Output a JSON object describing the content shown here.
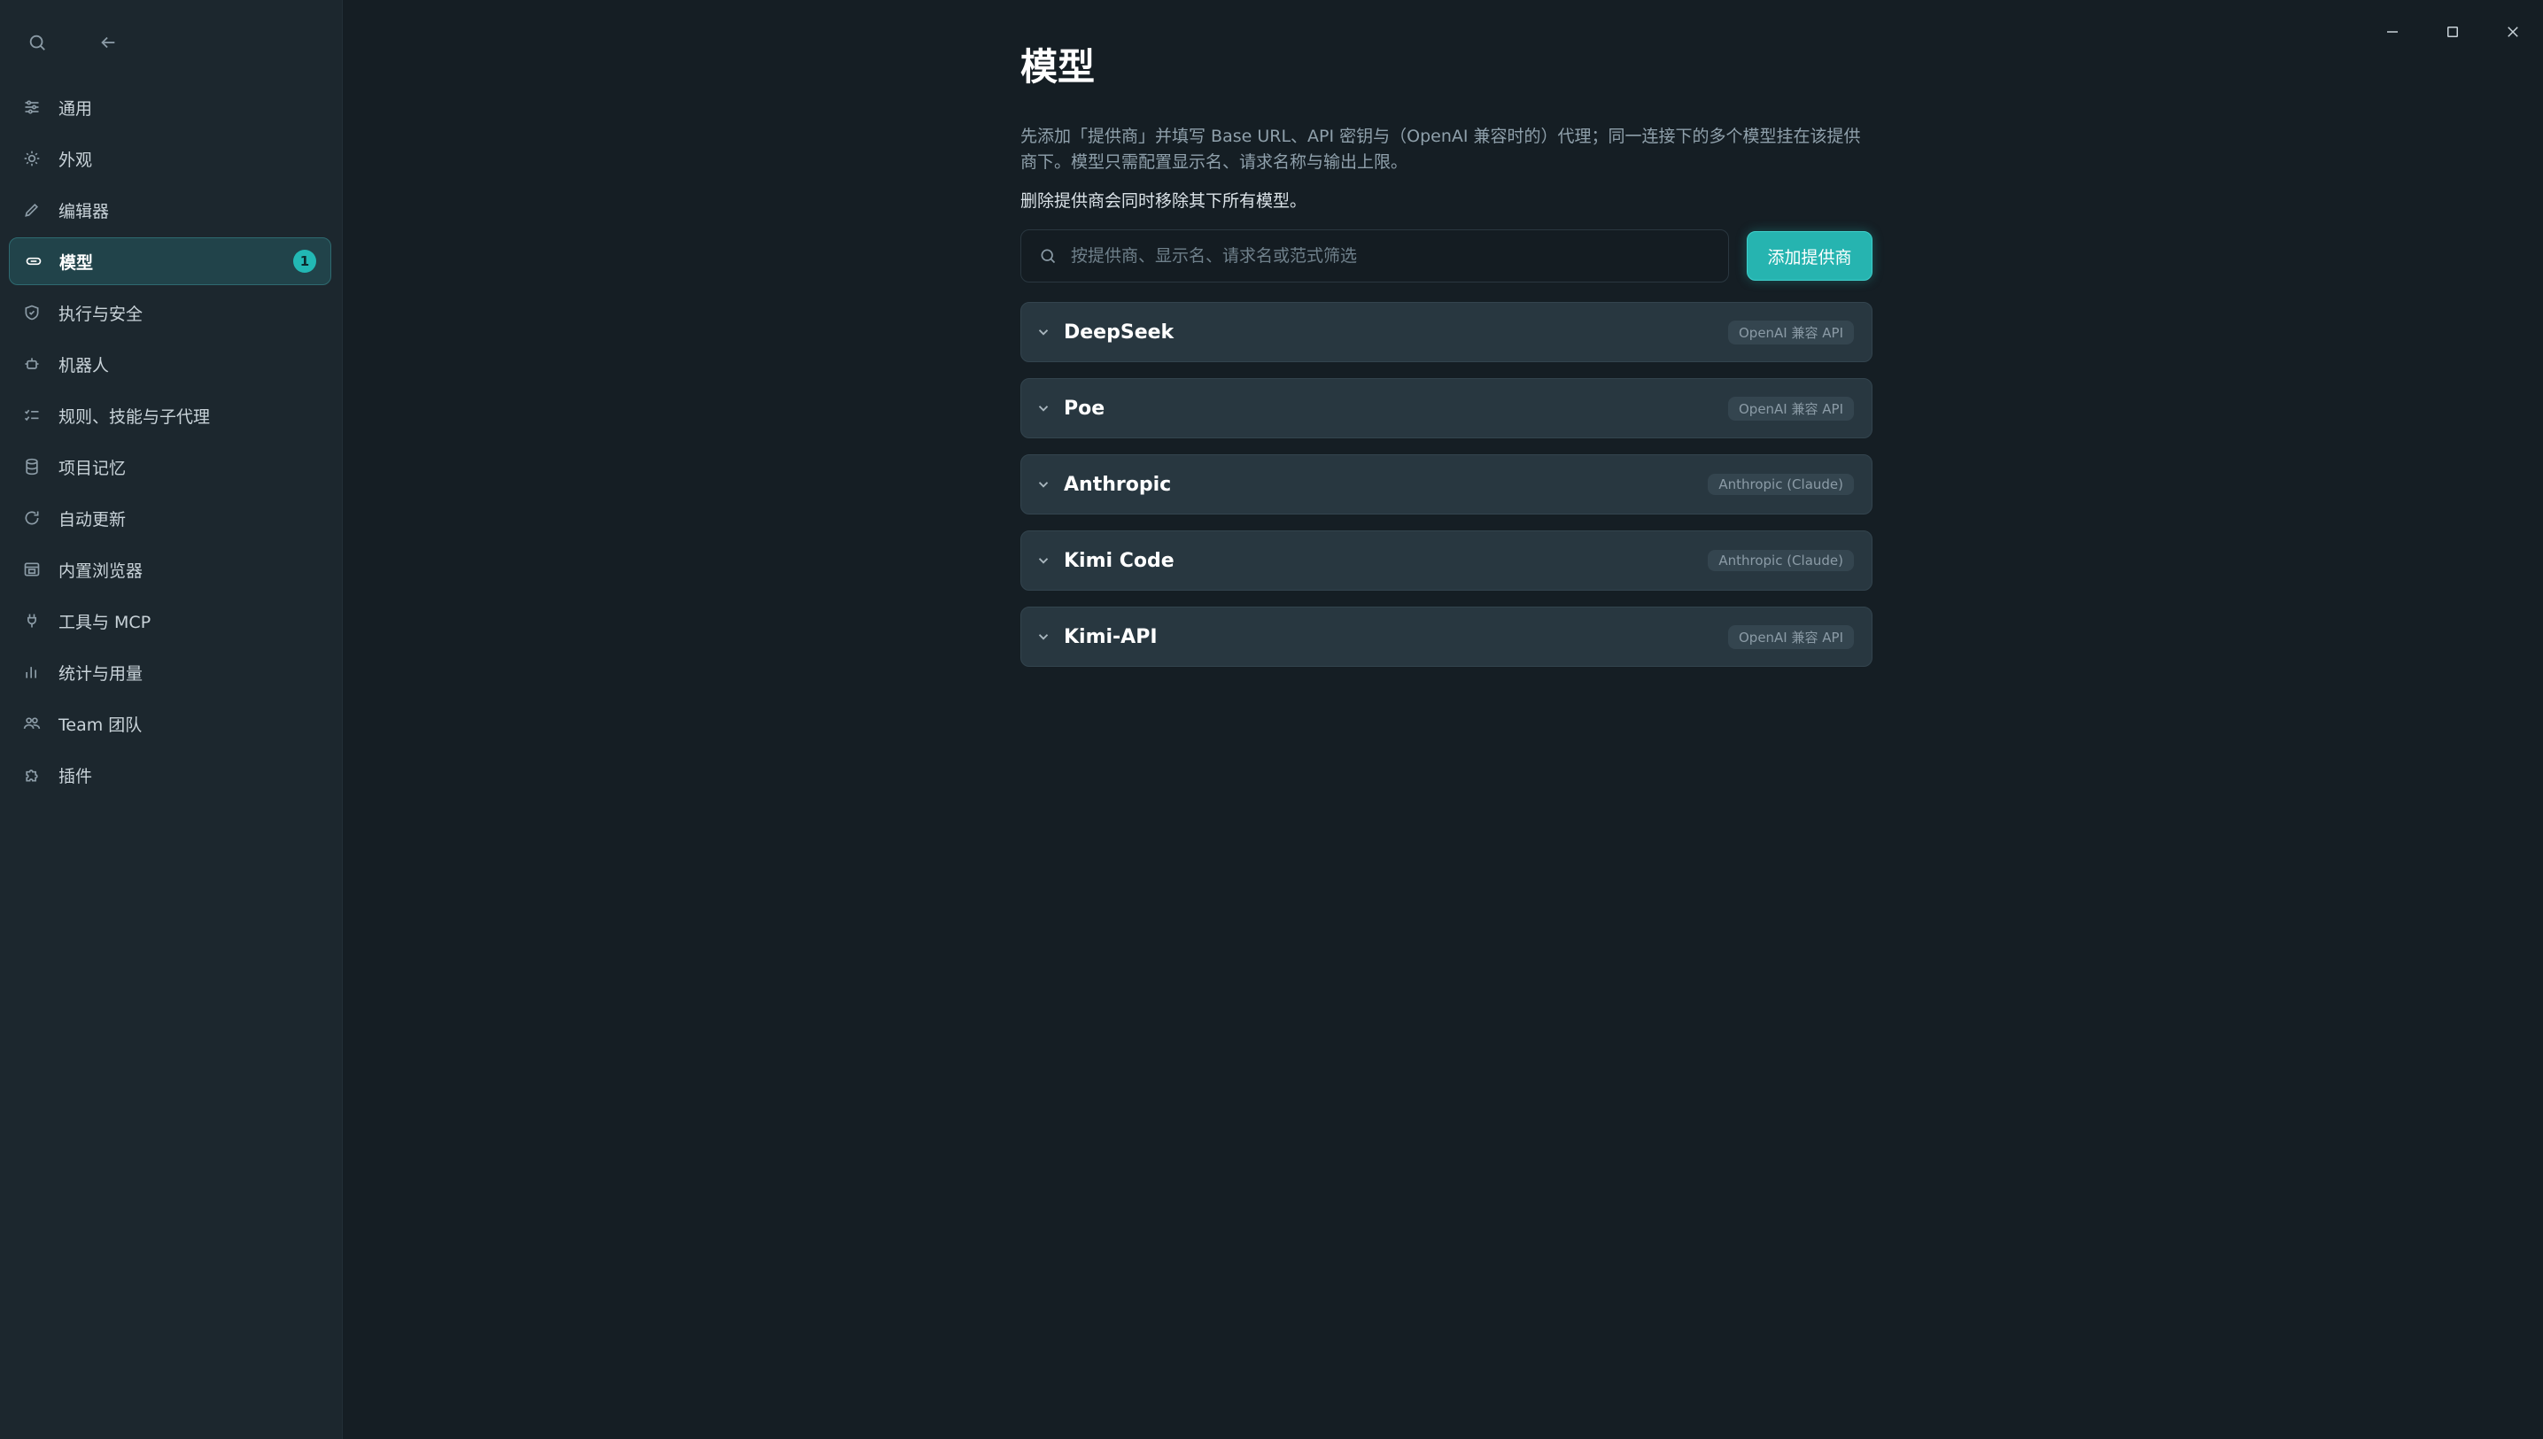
{
  "sidebar": {
    "items": [
      {
        "label": "通用",
        "icon": "sliders-icon"
      },
      {
        "label": "外观",
        "icon": "sun-icon"
      },
      {
        "label": "编辑器",
        "icon": "pencil-icon"
      },
      {
        "label": "模型",
        "icon": "link-icon",
        "active": true,
        "badge": "1"
      },
      {
        "label": "执行与安全",
        "icon": "shield-icon"
      },
      {
        "label": "机器人",
        "icon": "robot-icon"
      },
      {
        "label": "规则、技能与子代理",
        "icon": "rules-icon"
      },
      {
        "label": "项目记忆",
        "icon": "database-icon"
      },
      {
        "label": "自动更新",
        "icon": "refresh-icon"
      },
      {
        "label": "内置浏览器",
        "icon": "browser-icon"
      },
      {
        "label": "工具与 MCP",
        "icon": "plug-icon"
      },
      {
        "label": "统计与用量",
        "icon": "bar-chart-icon"
      },
      {
        "label": "Team 团队",
        "icon": "team-icon"
      },
      {
        "label": "插件",
        "icon": "puzzle-icon"
      }
    ]
  },
  "main": {
    "title": "模型",
    "description": "先添加「提供商」并填写 Base URL、API 密钥与（OpenAI 兼容时的）代理；同一连接下的多个模型挂在该提供商下。模型只需配置显示名、请求名称与输出上限。",
    "note": "删除提供商会同时移除其下所有模型。",
    "search_placeholder": "按提供商、显示名、请求名或范式筛选",
    "add_button": "添加提供商",
    "providers": [
      {
        "name": "DeepSeek",
        "tag": "OpenAI 兼容 API"
      },
      {
        "name": "Poe",
        "tag": "OpenAI 兼容 API"
      },
      {
        "name": "Anthropic",
        "tag": "Anthropic (Claude)"
      },
      {
        "name": "Kimi Code",
        "tag": "Anthropic (Claude)"
      },
      {
        "name": "Kimi-API",
        "tag": "OpenAI 兼容 API"
      }
    ]
  },
  "colors": {
    "accent": "#26b4b0",
    "background": "#151e24",
    "sidebar": "#1c272e"
  }
}
